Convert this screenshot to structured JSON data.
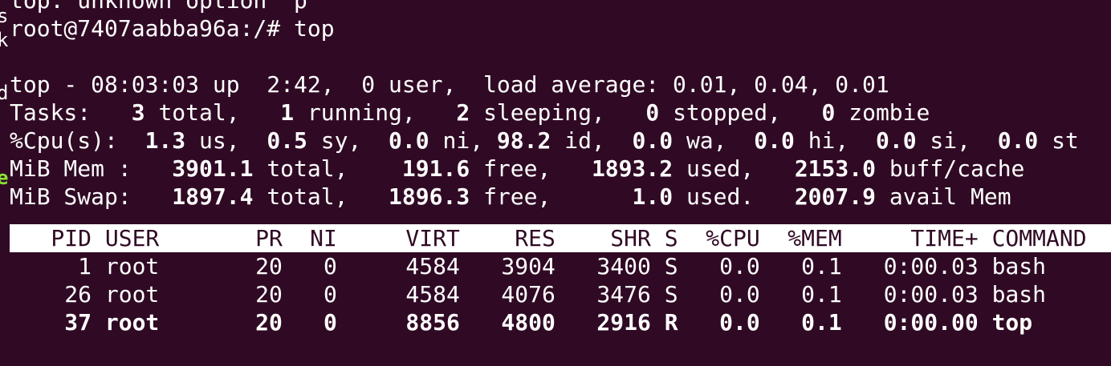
{
  "terminal": {
    "cut_line": "top: unknown option 'p'",
    "prompt": "root@7407aabba96a:/# top",
    "summary": {
      "line1": "top - 08:03:03 up  2:42,  0 user,  load average: 0.01, 0.04, 0.01",
      "tasks": {
        "label": "Tasks:",
        "total": "3",
        "total_lbl": "total,",
        "running": "1",
        "running_lbl": "running,",
        "sleeping": "2",
        "sleeping_lbl": "sleeping,",
        "stopped": "0",
        "stopped_lbl": "stopped,",
        "zombie": "0",
        "zombie_lbl": "zombie"
      },
      "cpu": {
        "label": "%Cpu(s):",
        "us": "1.3",
        "us_lbl": "us,",
        "sy": "0.5",
        "sy_lbl": "sy,",
        "ni": "0.0",
        "ni_lbl": "ni,",
        "id": "98.2",
        "id_lbl": "id,",
        "wa": "0.0",
        "wa_lbl": "wa,",
        "hi": "0.0",
        "hi_lbl": "hi,",
        "si": "0.0",
        "si_lbl": "si,",
        "st": "0.0",
        "st_lbl": "st"
      },
      "mem": {
        "label": "MiB Mem :",
        "total": "3901.1",
        "total_lbl": "total,",
        "free": "191.6",
        "free_lbl": "free,",
        "used": "1893.2",
        "used_lbl": "used,",
        "buff": "2153.0",
        "buff_lbl": "buff/cache"
      },
      "swap": {
        "label": "MiB Swap:",
        "total": "1897.4",
        "total_lbl": "total,",
        "free": "1896.3",
        "free_lbl": "free,",
        "used": "1.0",
        "used_lbl": "used.",
        "avail": "2007.9",
        "avail_lbl": "avail Mem"
      }
    },
    "columns": [
      "PID",
      "USER",
      "PR",
      "NI",
      "VIRT",
      "RES",
      "SHR",
      "S",
      "%CPU",
      "%MEM",
      "TIME+",
      "COMMAND"
    ],
    "processes": [
      {
        "pid": "1",
        "user": "root",
        "pr": "20",
        "ni": "0",
        "virt": "4584",
        "res": "3904",
        "shr": "3400",
        "s": "S",
        "cpu": "0.0",
        "mem": "0.1",
        "time": "0:00.03",
        "cmd": "bash"
      },
      {
        "pid": "26",
        "user": "root",
        "pr": "20",
        "ni": "0",
        "virt": "4584",
        "res": "4076",
        "shr": "3476",
        "s": "S",
        "cpu": "0.0",
        "mem": "0.1",
        "time": "0:00.03",
        "cmd": "bash"
      },
      {
        "pid": "37",
        "user": "root",
        "pr": "20",
        "ni": "0",
        "virt": "8856",
        "res": "4800",
        "shr": "2916",
        "s": "R",
        "cpu": "0.0",
        "mem": "0.1",
        "time": "0:00.00",
        "cmd": "top"
      }
    ],
    "gutter_chars": [
      "s",
      "k",
      "d",
      "e"
    ],
    "colors": {
      "background": "#300a24",
      "foreground": "#ffffff",
      "accent": "#8ae234"
    }
  }
}
